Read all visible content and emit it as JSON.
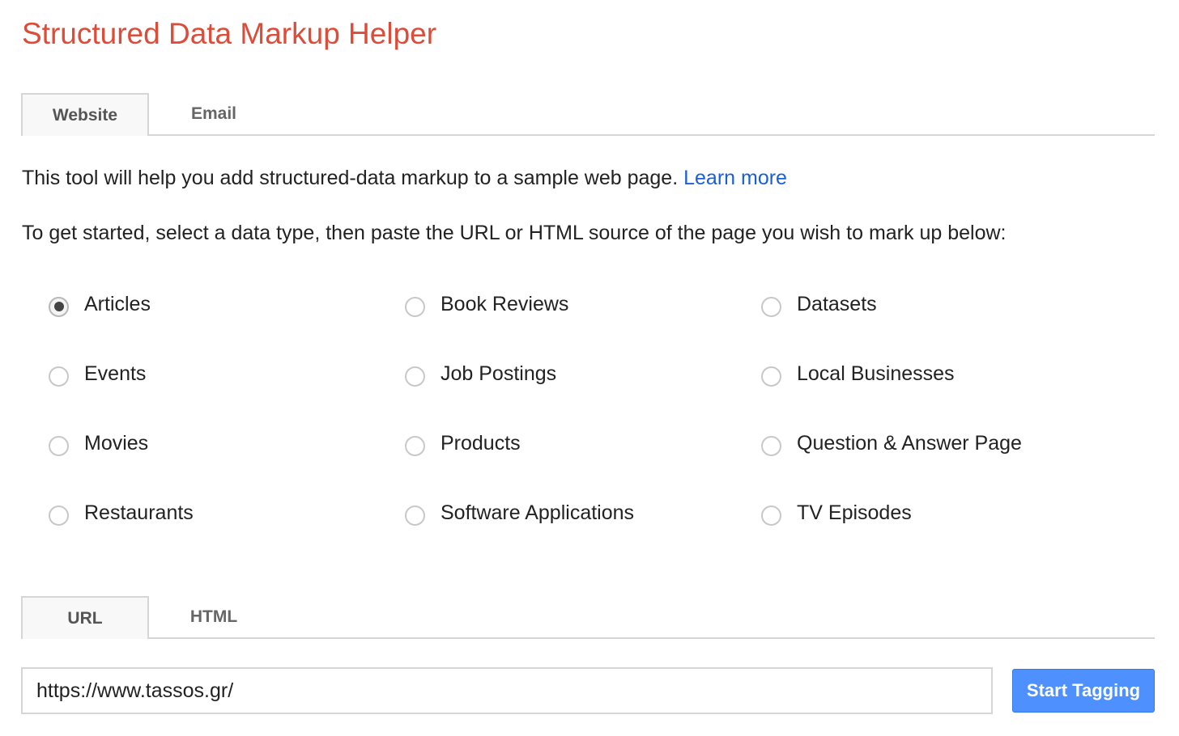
{
  "page": {
    "title": "Structured Data Markup Helper"
  },
  "top_tabs": [
    {
      "label": "Website",
      "active": true
    },
    {
      "label": "Email",
      "active": false
    }
  ],
  "intro": {
    "text": "This tool will help you add structured-data markup to a sample web page. ",
    "link": "Learn more"
  },
  "instructions": "To get started, select a data type, then paste the URL or HTML source of the page you wish to mark up below:",
  "data_types": [
    {
      "label": "Articles",
      "checked": true
    },
    {
      "label": "Book Reviews",
      "checked": false
    },
    {
      "label": "Datasets",
      "checked": false
    },
    {
      "label": "Events",
      "checked": false
    },
    {
      "label": "Job Postings",
      "checked": false
    },
    {
      "label": "Local Businesses",
      "checked": false
    },
    {
      "label": "Movies",
      "checked": false
    },
    {
      "label": "Products",
      "checked": false
    },
    {
      "label": "Question & Answer Page",
      "checked": false
    },
    {
      "label": "Restaurants",
      "checked": false
    },
    {
      "label": "Software Applications",
      "checked": false
    },
    {
      "label": "TV Episodes",
      "checked": false
    }
  ],
  "source_tabs": [
    {
      "label": "URL",
      "active": true
    },
    {
      "label": "HTML",
      "active": false
    }
  ],
  "url_input": {
    "value": "https://www.tassos.gr/"
  },
  "start_button": {
    "label": "Start Tagging"
  },
  "colors": {
    "title": "#dd4b39",
    "link": "#1a5fd6",
    "button": "#4d90fe"
  }
}
